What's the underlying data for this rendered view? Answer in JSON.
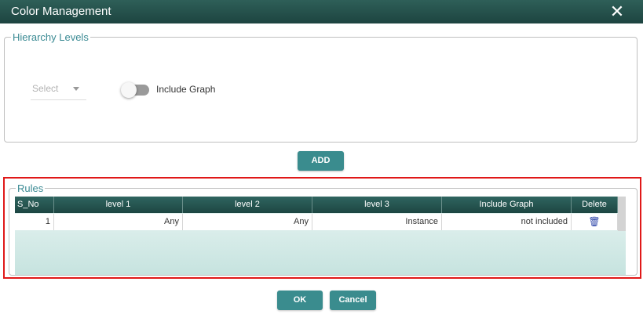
{
  "dialog": {
    "title": "Color Management",
    "close_icon": "close-icon"
  },
  "hierarchy": {
    "legend": "Hierarchy Levels",
    "select": {
      "value": "Select"
    },
    "include_graph": {
      "label": "Include Graph",
      "checked": false
    }
  },
  "buttons": {
    "add": "ADD",
    "ok": "OK",
    "cancel": "Cancel"
  },
  "rules": {
    "legend": "Rules",
    "columns": [
      "S_No",
      "level 1",
      "level 2",
      "level 3",
      "Include Graph",
      "Delete"
    ],
    "rows": [
      {
        "s_no": "1",
        "level1": "Any",
        "level2": "Any",
        "level3": "Instance",
        "include_graph": "not included",
        "delete_icon": "trash-icon"
      }
    ]
  },
  "colors": {
    "header": "#1d4440",
    "accent": "#3a8c8e",
    "legend_text": "#3a8a93",
    "highlight": "#e01818"
  }
}
